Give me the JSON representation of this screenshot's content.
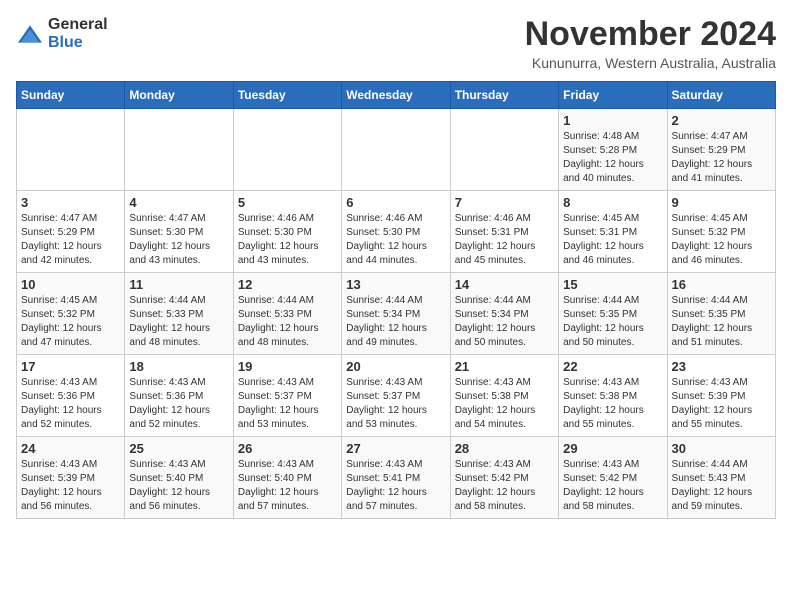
{
  "logo": {
    "general": "General",
    "blue": "Blue"
  },
  "title": "November 2024",
  "subtitle": "Kununurra, Western Australia, Australia",
  "weekdays": [
    "Sunday",
    "Monday",
    "Tuesday",
    "Wednesday",
    "Thursday",
    "Friday",
    "Saturday"
  ],
  "weeks": [
    [
      {
        "day": "",
        "info": ""
      },
      {
        "day": "",
        "info": ""
      },
      {
        "day": "",
        "info": ""
      },
      {
        "day": "",
        "info": ""
      },
      {
        "day": "",
        "info": ""
      },
      {
        "day": "1",
        "info": "Sunrise: 4:48 AM\nSunset: 5:28 PM\nDaylight: 12 hours\nand 40 minutes."
      },
      {
        "day": "2",
        "info": "Sunrise: 4:47 AM\nSunset: 5:29 PM\nDaylight: 12 hours\nand 41 minutes."
      }
    ],
    [
      {
        "day": "3",
        "info": "Sunrise: 4:47 AM\nSunset: 5:29 PM\nDaylight: 12 hours\nand 42 minutes."
      },
      {
        "day": "4",
        "info": "Sunrise: 4:47 AM\nSunset: 5:30 PM\nDaylight: 12 hours\nand 43 minutes."
      },
      {
        "day": "5",
        "info": "Sunrise: 4:46 AM\nSunset: 5:30 PM\nDaylight: 12 hours\nand 43 minutes."
      },
      {
        "day": "6",
        "info": "Sunrise: 4:46 AM\nSunset: 5:30 PM\nDaylight: 12 hours\nand 44 minutes."
      },
      {
        "day": "7",
        "info": "Sunrise: 4:46 AM\nSunset: 5:31 PM\nDaylight: 12 hours\nand 45 minutes."
      },
      {
        "day": "8",
        "info": "Sunrise: 4:45 AM\nSunset: 5:31 PM\nDaylight: 12 hours\nand 46 minutes."
      },
      {
        "day": "9",
        "info": "Sunrise: 4:45 AM\nSunset: 5:32 PM\nDaylight: 12 hours\nand 46 minutes."
      }
    ],
    [
      {
        "day": "10",
        "info": "Sunrise: 4:45 AM\nSunset: 5:32 PM\nDaylight: 12 hours\nand 47 minutes."
      },
      {
        "day": "11",
        "info": "Sunrise: 4:44 AM\nSunset: 5:33 PM\nDaylight: 12 hours\nand 48 minutes."
      },
      {
        "day": "12",
        "info": "Sunrise: 4:44 AM\nSunset: 5:33 PM\nDaylight: 12 hours\nand 48 minutes."
      },
      {
        "day": "13",
        "info": "Sunrise: 4:44 AM\nSunset: 5:34 PM\nDaylight: 12 hours\nand 49 minutes."
      },
      {
        "day": "14",
        "info": "Sunrise: 4:44 AM\nSunset: 5:34 PM\nDaylight: 12 hours\nand 50 minutes."
      },
      {
        "day": "15",
        "info": "Sunrise: 4:44 AM\nSunset: 5:35 PM\nDaylight: 12 hours\nand 50 minutes."
      },
      {
        "day": "16",
        "info": "Sunrise: 4:44 AM\nSunset: 5:35 PM\nDaylight: 12 hours\nand 51 minutes."
      }
    ],
    [
      {
        "day": "17",
        "info": "Sunrise: 4:43 AM\nSunset: 5:36 PM\nDaylight: 12 hours\nand 52 minutes."
      },
      {
        "day": "18",
        "info": "Sunrise: 4:43 AM\nSunset: 5:36 PM\nDaylight: 12 hours\nand 52 minutes."
      },
      {
        "day": "19",
        "info": "Sunrise: 4:43 AM\nSunset: 5:37 PM\nDaylight: 12 hours\nand 53 minutes."
      },
      {
        "day": "20",
        "info": "Sunrise: 4:43 AM\nSunset: 5:37 PM\nDaylight: 12 hours\nand 53 minutes."
      },
      {
        "day": "21",
        "info": "Sunrise: 4:43 AM\nSunset: 5:38 PM\nDaylight: 12 hours\nand 54 minutes."
      },
      {
        "day": "22",
        "info": "Sunrise: 4:43 AM\nSunset: 5:38 PM\nDaylight: 12 hours\nand 55 minutes."
      },
      {
        "day": "23",
        "info": "Sunrise: 4:43 AM\nSunset: 5:39 PM\nDaylight: 12 hours\nand 55 minutes."
      }
    ],
    [
      {
        "day": "24",
        "info": "Sunrise: 4:43 AM\nSunset: 5:39 PM\nDaylight: 12 hours\nand 56 minutes."
      },
      {
        "day": "25",
        "info": "Sunrise: 4:43 AM\nSunset: 5:40 PM\nDaylight: 12 hours\nand 56 minutes."
      },
      {
        "day": "26",
        "info": "Sunrise: 4:43 AM\nSunset: 5:40 PM\nDaylight: 12 hours\nand 57 minutes."
      },
      {
        "day": "27",
        "info": "Sunrise: 4:43 AM\nSunset: 5:41 PM\nDaylight: 12 hours\nand 57 minutes."
      },
      {
        "day": "28",
        "info": "Sunrise: 4:43 AM\nSunset: 5:42 PM\nDaylight: 12 hours\nand 58 minutes."
      },
      {
        "day": "29",
        "info": "Sunrise: 4:43 AM\nSunset: 5:42 PM\nDaylight: 12 hours\nand 58 minutes."
      },
      {
        "day": "30",
        "info": "Sunrise: 4:44 AM\nSunset: 5:43 PM\nDaylight: 12 hours\nand 59 minutes."
      }
    ]
  ]
}
